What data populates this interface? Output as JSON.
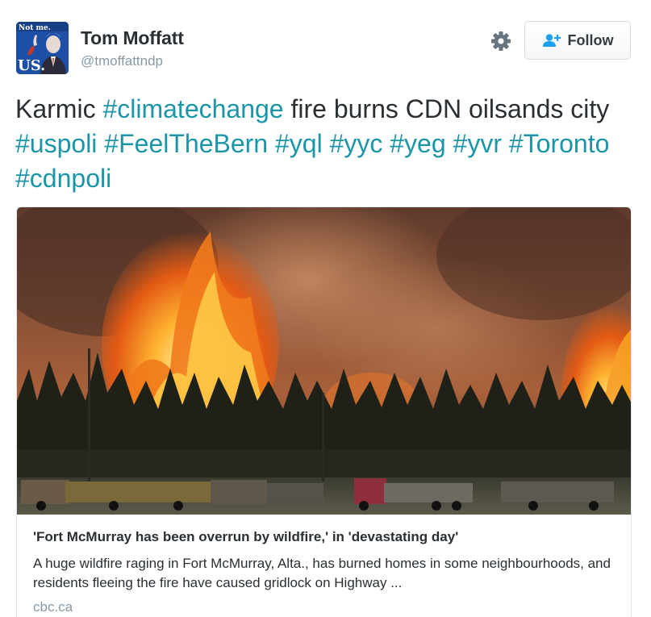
{
  "user": {
    "name": "Tom Moffatt",
    "handle": "@tmoffattndp",
    "avatar": {
      "top_text": "Not me.",
      "bottom_text": "US."
    }
  },
  "actions": {
    "settings_icon": "gear-icon",
    "follow_icon": "add-user-icon",
    "follow_label": "Follow"
  },
  "tweet": {
    "segments": [
      {
        "text": "Karmic ",
        "hashtag": false
      },
      {
        "text": "#climatechange",
        "hashtag": true
      },
      {
        "text": " fire burns CDN oilsands city ",
        "hashtag": false
      },
      {
        "text": "#uspoli",
        "hashtag": true
      },
      {
        "text": " ",
        "hashtag": false
      },
      {
        "text": "#FeelTheBern",
        "hashtag": true
      },
      {
        "text": " ",
        "hashtag": false
      },
      {
        "text": "#yql",
        "hashtag": true
      },
      {
        "text": " ",
        "hashtag": false
      },
      {
        "text": "#yyc",
        "hashtag": true
      },
      {
        "text": " ",
        "hashtag": false
      },
      {
        "text": "#yeg",
        "hashtag": true
      },
      {
        "text": " ",
        "hashtag": false
      },
      {
        "text": "#yvr",
        "hashtag": true
      },
      {
        "text": " ",
        "hashtag": false
      },
      {
        "text": "#Toronto",
        "hashtag": true
      },
      {
        "text": " ",
        "hashtag": false
      },
      {
        "text": "#cdnpoli",
        "hashtag": true
      }
    ]
  },
  "card": {
    "title": "'Fort McMurray has been overrun by wildfire,' in 'devastating day'",
    "description": "A huge wildfire raging in Fort McMurray, Alta., has burned homes in some neighbourhoods, and residents fleeing the fire have caused gridlock on Highway ...",
    "domain": "cbc.ca"
  },
  "colors": {
    "hashtag": "#1b95a8",
    "text": "#292f33",
    "muted": "#8899a6",
    "follow_icon": "#1da1f2",
    "avatar_bg": "#1d4fa6"
  }
}
